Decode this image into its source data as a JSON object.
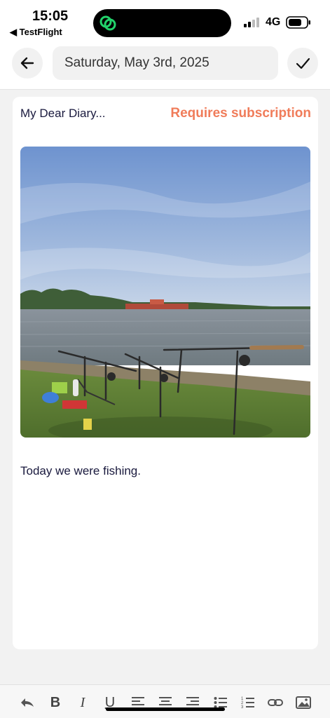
{
  "status_bar": {
    "time": "15:05",
    "back_app": "◀ TestFlight",
    "network": "4G"
  },
  "header": {
    "date": "Saturday, May 3rd, 2025",
    "back_icon": "arrow-left-icon",
    "confirm_icon": "checkmark-icon"
  },
  "entry": {
    "title": "My Dear Diary...",
    "subscription_label": "Requires subscription",
    "image_subject": "fishing rods on grassy lake shore",
    "body": "Today we were fishing."
  },
  "toolbar": {
    "items": [
      "undo-icon",
      "bold-icon",
      "italic-icon",
      "underline-icon",
      "align-left-icon",
      "align-center-icon",
      "align-right-icon",
      "bullet-list-icon",
      "numbered-list-icon",
      "link-icon",
      "image-icon"
    ],
    "bold_glyph": "B",
    "italic_glyph": "I",
    "underline_glyph": "U"
  },
  "colors": {
    "accent": "#f07c5a",
    "text": "#1a1a3e",
    "background": "#f2f2f2"
  }
}
